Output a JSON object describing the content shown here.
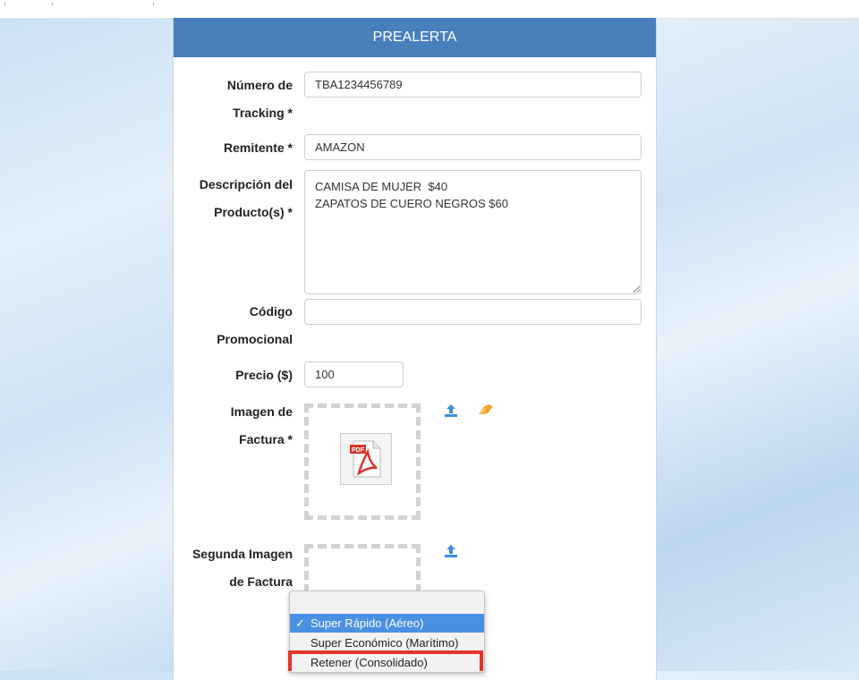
{
  "header": {
    "title": "PREALERTA"
  },
  "form": {
    "tracking": {
      "label_1": "Número de",
      "label_2": "Tracking *",
      "value": "TBA1234456789"
    },
    "sender": {
      "label": "Remitente *",
      "value": "AMAZON"
    },
    "description": {
      "label_1": "Descripción del",
      "label_2": "Producto(s) *",
      "value": "CAMISA DE MUJER  $40\nZAPATOS DE CUERO NEGROS $60"
    },
    "promo": {
      "label_1": "Código",
      "label_2": "Promocional",
      "value": ""
    },
    "price": {
      "label": "Precio ($)",
      "value": "100"
    },
    "invoice_image": {
      "label_1": "Imagen de",
      "label_2": "Factura *",
      "file_icon": "pdf-file-icon",
      "pdf_badge": "PDF"
    },
    "second_invoice_image": {
      "label_1": "Segunda Imagen",
      "label_2": "de Factura"
    }
  },
  "icons": {
    "upload": "upload-icon",
    "eraser": "eraser-icon"
  },
  "colors": {
    "header_bg": "#4a7fbd",
    "upload_icon": "#3a8ee6",
    "eraser_icon": "#f0a32b",
    "selected_option": "#4a90e2",
    "highlight": "#e8332a"
  },
  "shipping_dropdown": {
    "selected_index": 0,
    "options": [
      {
        "label": "Super Rápido (Aéreo)",
        "check": "✓"
      },
      {
        "label": "Super Económico (Marítimo)"
      },
      {
        "label": "Retener (Consolidado)"
      }
    ]
  }
}
